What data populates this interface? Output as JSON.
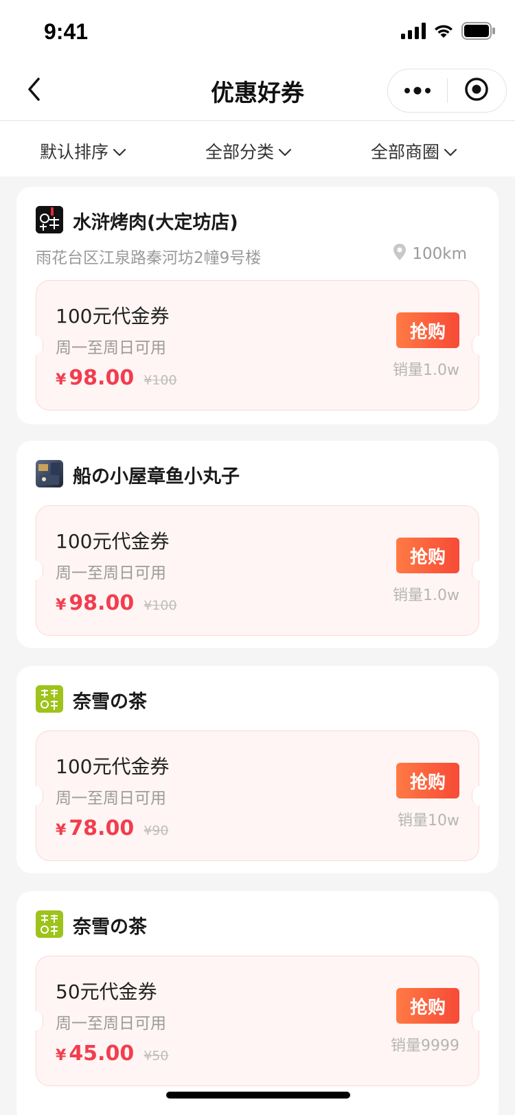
{
  "status": {
    "time": "9:41"
  },
  "nav": {
    "title": "优惠好券"
  },
  "filters": [
    {
      "label": "默认排序"
    },
    {
      "label": "全部分类"
    },
    {
      "label": "全部商圈"
    }
  ],
  "shops": [
    {
      "name": "水浒烤肉(大定坊店)",
      "address": "雨花台区江泉路秦河坊2幢9号楼",
      "distance": "100km",
      "coupon": {
        "title": "100元代金券",
        "desc": "周一至周日可用",
        "symbol": "¥",
        "price": "98.00",
        "orig": "¥100",
        "buy": "抢购",
        "sales": "销量1.0w"
      }
    },
    {
      "name": "船の小屋章鱼小丸子",
      "coupon": {
        "title": "100元代金券",
        "desc": "周一至周日可用",
        "symbol": "¥",
        "price": "98.00",
        "orig": "¥100",
        "buy": "抢购",
        "sales": "销量1.0w"
      }
    },
    {
      "name": "奈雪の茶",
      "coupon": {
        "title": "100元代金券",
        "desc": "周一至周日可用",
        "symbol": "¥",
        "price": "78.00",
        "orig": "¥90",
        "buy": "抢购",
        "sales": "销量10w"
      }
    },
    {
      "name": "奈雪の茶",
      "coupon": {
        "title": "50元代金券",
        "desc": "周一至周日可用",
        "symbol": "¥",
        "price": "45.00",
        "orig": "¥50",
        "buy": "抢购",
        "sales": "销量9999"
      }
    }
  ],
  "logos": {
    "naixue": "奈雪の茶"
  },
  "colors": {
    "accent": "#f23d4f",
    "button": "#f74a36",
    "coupon_bg": "#fff5f4"
  }
}
